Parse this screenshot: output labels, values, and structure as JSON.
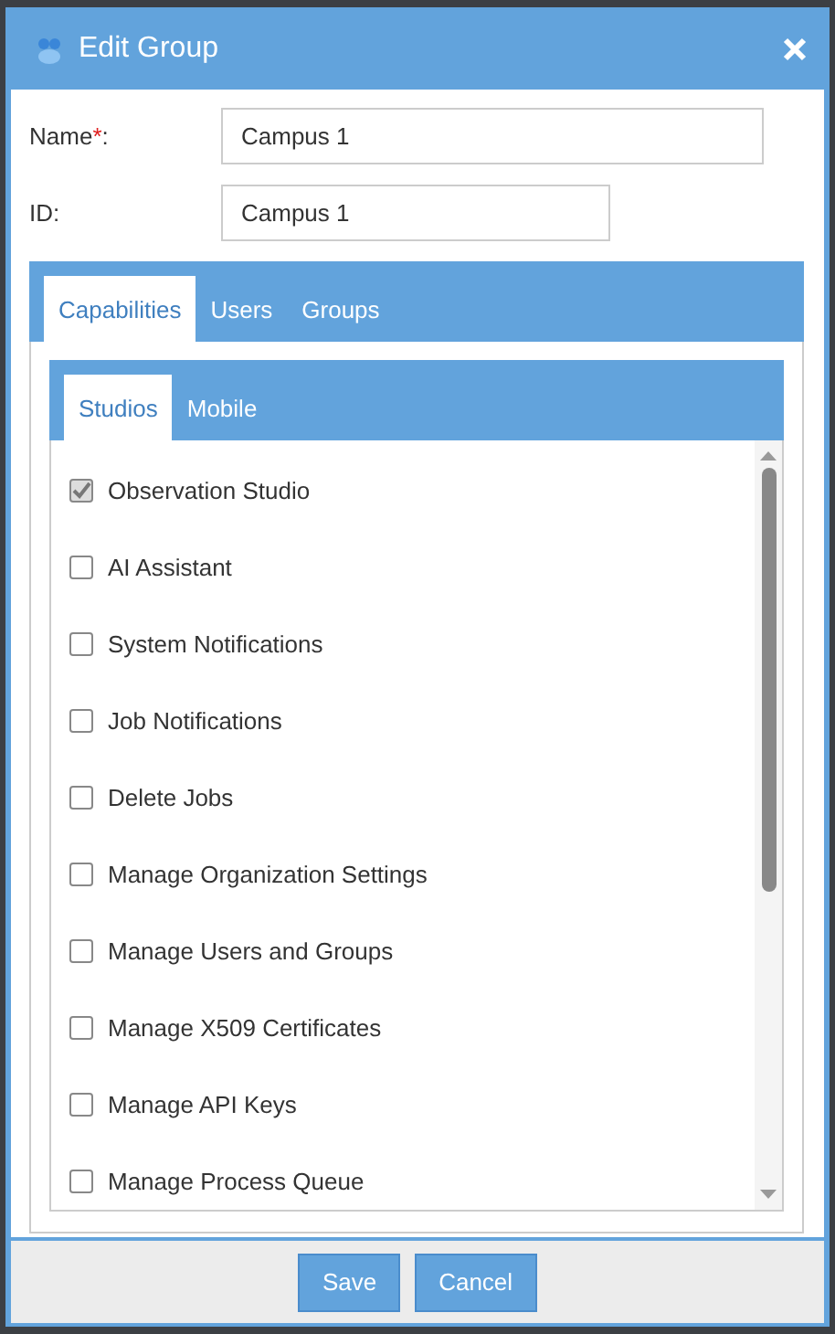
{
  "window": {
    "title": "Edit Group"
  },
  "fields": [
    {
      "label": "Name",
      "required_mark": "*",
      "colon": ":",
      "value": "Campus 1",
      "wide": true
    },
    {
      "label": "ID",
      "colon": ":",
      "value": "Campus 1",
      "wide": false
    }
  ],
  "tabs": [
    {
      "label": "Capabilities",
      "selected": true
    },
    {
      "label": "Users",
      "selected": false
    },
    {
      "label": "Groups",
      "selected": false
    }
  ],
  "subtabs": [
    {
      "label": "Studios",
      "selected": true
    },
    {
      "label": "Mobile",
      "selected": false
    }
  ],
  "capabilities": [
    {
      "label": "Observation Studio",
      "checked": true
    },
    {
      "label": "AI Assistant",
      "checked": false
    },
    {
      "label": "System Notifications",
      "checked": false
    },
    {
      "label": "Job Notifications",
      "checked": false
    },
    {
      "label": "Delete Jobs",
      "checked": false
    },
    {
      "label": "Manage Organization Settings",
      "checked": false
    },
    {
      "label": "Manage Users and Groups",
      "checked": false
    },
    {
      "label": "Manage X509 Certificates",
      "checked": false
    },
    {
      "label": "Manage API Keys",
      "checked": false
    },
    {
      "label": "Manage Process Queue",
      "checked": false
    }
  ],
  "buttons": [
    "Save",
    "Cancel"
  ]
}
